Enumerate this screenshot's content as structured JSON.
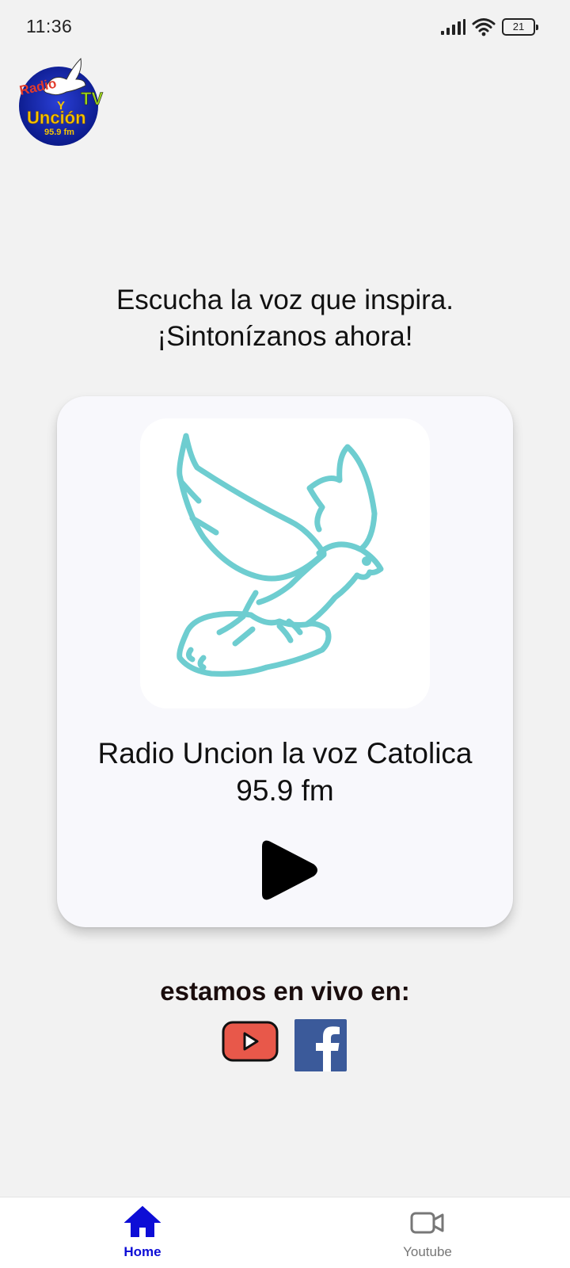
{
  "status_bar": {
    "time": "11:36",
    "battery_level": "21",
    "icons": [
      "signal-icon",
      "wifi-icon",
      "battery-icon"
    ]
  },
  "logo": {
    "text_radio": "Radio",
    "text_y": "Y",
    "text_tv": "TV",
    "text_uncion": "Unción",
    "text_freq": "95.9 fm"
  },
  "tagline": {
    "line1": "Escucha la voz que inspira.",
    "line2": "¡Sintonízanos ahora!"
  },
  "player": {
    "station_line1": "Radio Uncion la voz Catolica",
    "station_line2": "95.9 fm",
    "artwork_icon": "dove-icon",
    "play_icon": "play-icon"
  },
  "live": {
    "label": "estamos en vivo en:",
    "platforms": [
      "youtube-icon",
      "facebook-icon"
    ]
  },
  "bottom_nav": {
    "home_label": "Home",
    "youtube_label": "Youtube"
  },
  "colors": {
    "background": "#f2f2f2",
    "card": "#f8f8fc",
    "dove": "#6ecdd0",
    "nav_active": "#0d0dd6",
    "nav_inactive": "#777777",
    "youtube_red": "#e8584a",
    "facebook_blue": "#3b5a9a"
  }
}
